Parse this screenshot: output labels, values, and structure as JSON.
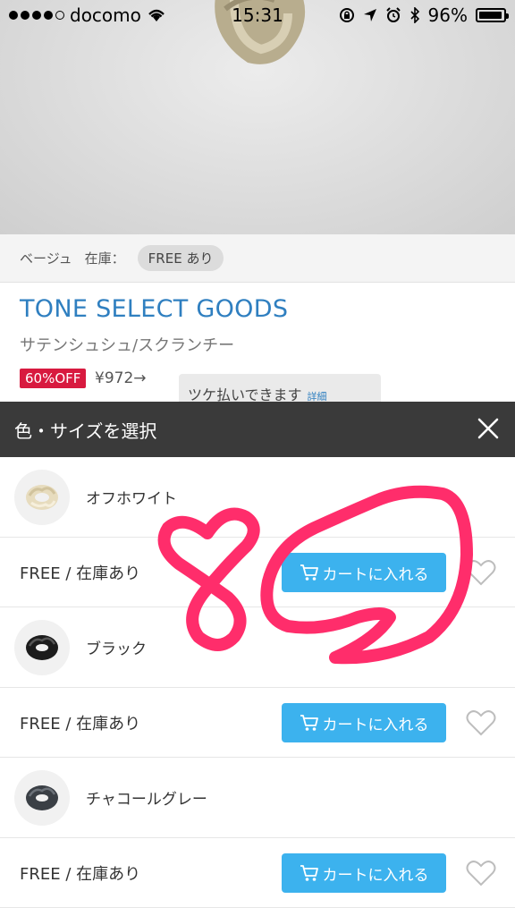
{
  "status_bar": {
    "carrier": "docomo",
    "time": "15:31",
    "battery": "96%",
    "battery_level": 0.96
  },
  "product": {
    "color_label": "ベージュ",
    "stock_label": "在庫：",
    "stock_pill": "FREE あり",
    "brand": "TONE SELECT GOODS",
    "name": "サテンシュシュ/スクランチー",
    "discount_badge": "60%OFF",
    "price": "¥972→",
    "payment_note": "ツケ払いできます",
    "payment_detail": "詳細"
  },
  "sheet": {
    "title": "色・サイズを選択",
    "variants": [
      {
        "name": "オフホワイト",
        "size": "FREE / 在庫あり",
        "cart_label": "カートに入れる",
        "thumb_color": "#efe6cf"
      },
      {
        "name": "ブラック",
        "size": "FREE / 在庫あり",
        "cart_label": "カートに入れる",
        "thumb_color": "#1c1c1c"
      },
      {
        "name": "チャコールグレー",
        "size": "FREE / 在庫あり",
        "cart_label": "カートに入れる",
        "thumb_color": "#3a3f45"
      }
    ]
  },
  "annotation": {
    "text": "80",
    "color": "#ff2d6b"
  },
  "colors": {
    "accent_blue": "#3cb2ee",
    "brand_blue": "#2f7fc0",
    "discount_red": "#d81a3f",
    "header_dark": "#3a3a3a"
  }
}
